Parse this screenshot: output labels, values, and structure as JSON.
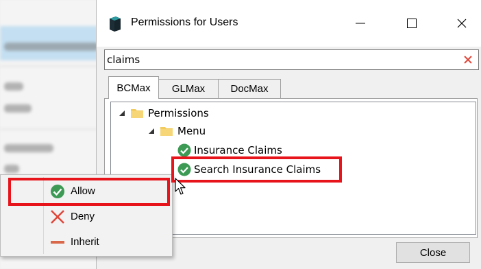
{
  "window": {
    "title": "Permissions for Users",
    "minimize_glyph": "—",
    "maximize_glyph": "☐",
    "close_glyph": "✕"
  },
  "search": {
    "value": "claims",
    "clear_icon": "x-icon"
  },
  "tabs": [
    {
      "label": "BCMax",
      "active": true
    },
    {
      "label": "GLMax",
      "active": false
    },
    {
      "label": "DocMax",
      "active": false
    }
  ],
  "tree": {
    "root": {
      "label": "Permissions",
      "expanded": true
    },
    "menu": {
      "label": "Menu",
      "expanded": true
    },
    "items": [
      {
        "label": "Insurance Claims",
        "state": "allow"
      },
      {
        "label": "Search Insurance Claims",
        "state": "allow"
      }
    ]
  },
  "close_button": {
    "label": "Close"
  },
  "context_menu": {
    "items": [
      {
        "label": "Allow",
        "icon": "check-circle-icon"
      },
      {
        "label": "Deny",
        "icon": "x-icon"
      },
      {
        "label": "Inherit",
        "icon": "dash-icon"
      }
    ]
  },
  "colors": {
    "highlight": "#e8141c",
    "allow_green": "#3c9a55",
    "deny_red": "#e0473a",
    "inherit_orange": "#d9684a",
    "folder_yellow": "#f2cc5c"
  }
}
